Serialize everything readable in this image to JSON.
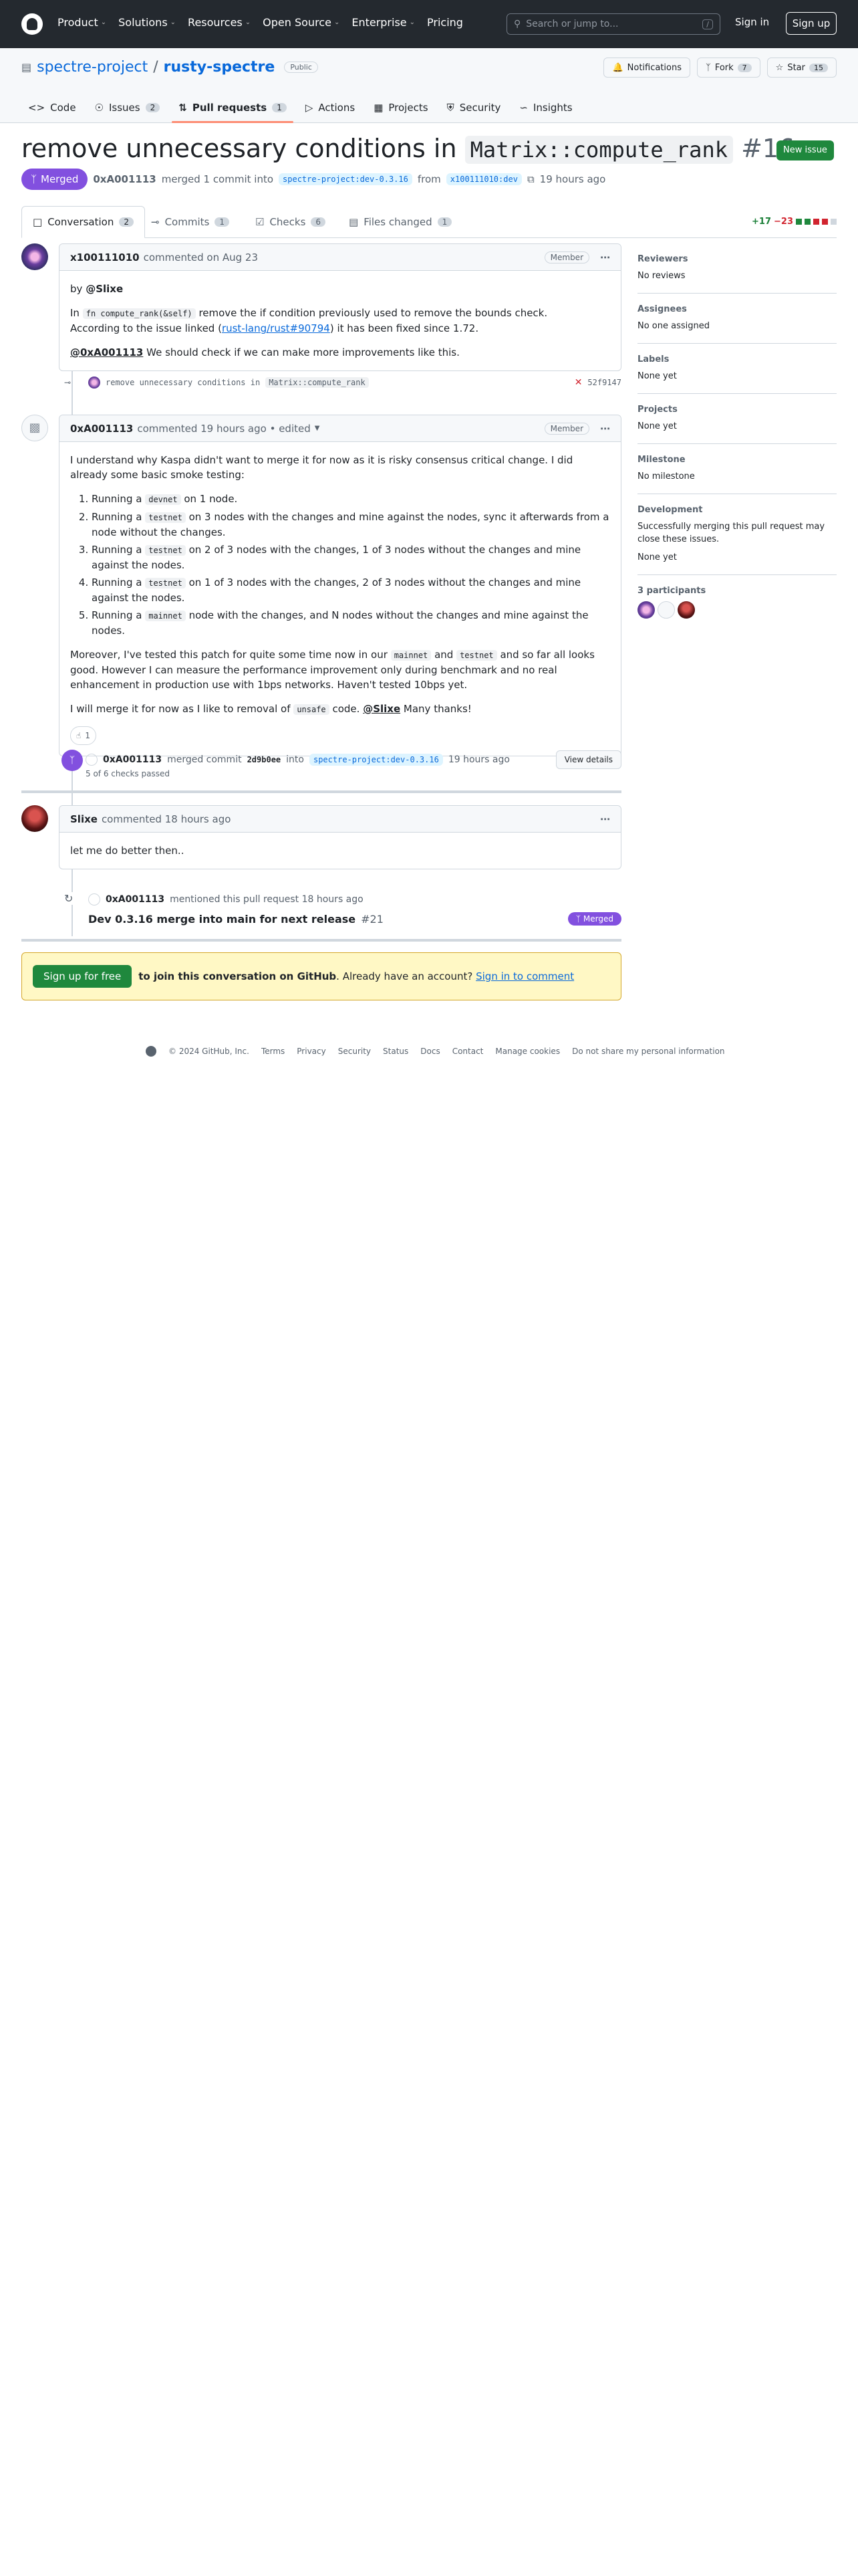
{
  "header": {
    "nav": [
      "Product",
      "Solutions",
      "Resources",
      "Open Source",
      "Enterprise",
      "Pricing"
    ],
    "search_placeholder": "Search or jump to...",
    "search_shortcut": "/",
    "signin": "Sign in",
    "signup": "Sign up"
  },
  "repo": {
    "owner": "spectre-project",
    "name": "rusty-spectre",
    "visibility": "Public",
    "notifications": "Notifications",
    "fork": "Fork",
    "fork_count": "7",
    "star": "Star",
    "star_count": "15",
    "tabs": [
      {
        "label": "Code",
        "count": ""
      },
      {
        "label": "Issues",
        "count": "2"
      },
      {
        "label": "Pull requests",
        "count": "1"
      },
      {
        "label": "Actions",
        "count": ""
      },
      {
        "label": "Projects",
        "count": ""
      },
      {
        "label": "Security",
        "count": ""
      },
      {
        "label": "Insights",
        "count": ""
      }
    ]
  },
  "pr": {
    "title_prefix": "remove unnecessary conditions in ",
    "title_code": "Matrix::compute_rank",
    "number": "#16",
    "new_issue": "New issue",
    "status": "Merged",
    "author": "0xA001113",
    "merge_text": "merged 1 commit into",
    "base_branch": "spectre-project:dev-0.3.16",
    "from": "from",
    "head_branch": "x100111010:dev",
    "time": "19 hours ago",
    "tabs": [
      {
        "label": "Conversation",
        "count": "2"
      },
      {
        "label": "Commits",
        "count": "1"
      },
      {
        "label": "Checks",
        "count": "6"
      },
      {
        "label": "Files changed",
        "count": "1"
      }
    ],
    "additions": "+17",
    "deletions": "−23"
  },
  "comments": {
    "c1": {
      "author": "x100111010",
      "meta": "commented on Aug 23",
      "role": "Member",
      "by": "by",
      "by_mention": "@Slixe",
      "line1_a": "In",
      "line1_code": "fn compute_rank(&self)",
      "line1_b": "remove the if condition previously used to remove the bounds check.",
      "line2_a": "According to the issue linked (",
      "line2_link": "rust-lang/rust#90794",
      "line2_b": ") it has been fixed since 1.72.",
      "line3_mention": "@0xA001113",
      "line3_b": "We should check if we can make more improvements like this."
    },
    "commit": {
      "text": "remove unnecessary conditions in",
      "code": "Matrix::compute_rank",
      "sha": "52f9147"
    },
    "c2": {
      "author": "0xA001113",
      "meta": "commented 19 hours ago • edited",
      "role": "Member",
      "p1": "I understand why Kaspa didn't want to merge it for now as it is risky consensus critical change. I did already some basic smoke testing:",
      "items": [
        {
          "a": "Running a",
          "code": "devnet",
          "b": "on 1 node."
        },
        {
          "a": "Running a",
          "code": "testnet",
          "b": "on 3 nodes with the changes and mine against the nodes, sync it afterwards from a node without the changes."
        },
        {
          "a": "Running a",
          "code": "testnet",
          "b": "on 2 of 3 nodes with the changes, 1 of 3 nodes without the changes and mine against the nodes."
        },
        {
          "a": "Running a",
          "code": "testnet",
          "b": "on 1 of 3 nodes with the changes, 2 of 3 nodes without the changes and mine against the nodes."
        },
        {
          "a": "Running a",
          "code": "mainnet",
          "b": "node with the changes, and N nodes without the changes and mine against the nodes."
        }
      ],
      "p2_a": "Moreover, I've tested this patch for quite some time now in our",
      "p2_code1": "mainnet",
      "p2_and": "and",
      "p2_code2": "testnet",
      "p2_b": "and so far all looks good. However I can measure the performance improvement only during benchmark and no real enhancement in production use with 1bps networks. Haven't tested 10bps yet.",
      "p3_a": "I will merge it for now as I like to removal of",
      "p3_code": "unsafe",
      "p3_b": "code.",
      "p3_mention": "@Slixe",
      "p3_c": "Many thanks!",
      "reaction_count": "1"
    },
    "merge_event": {
      "author": "0xA001113",
      "text": "merged commit",
      "sha": "2d9b0ee",
      "into": "into",
      "branch": "spectre-project:dev-0.3.16",
      "time": "19 hours ago",
      "checks": "5 of 6 checks passed",
      "view": "View details"
    },
    "c3": {
      "author": "Slixe",
      "meta": "commented 18 hours ago",
      "body": "let me do better then.."
    },
    "mention_event": {
      "author": "0xA001113",
      "text": "mentioned this pull request 18 hours ago",
      "ref_title": "Dev 0.3.16 merge into main for next release",
      "ref_num": "#21",
      "ref_status": "Merged"
    }
  },
  "signup_box": {
    "button": "Sign up for free",
    "bold": "to join this conversation on GitHub",
    "text": ". Already have an account?",
    "link": "Sign in to comment"
  },
  "sidebar": {
    "reviewers_h": "Reviewers",
    "reviewers_v": "No reviews",
    "assignees_h": "Assignees",
    "assignees_v": "No one assigned",
    "labels_h": "Labels",
    "labels_v": "None yet",
    "projects_h": "Projects",
    "projects_v": "None yet",
    "milestone_h": "Milestone",
    "milestone_v": "No milestone",
    "development_h": "Development",
    "development_p": "Successfully merging this pull request may close these issues.",
    "development_v": "None yet",
    "participants_h": "3 participants"
  },
  "footer": [
    "© 2024 GitHub, Inc.",
    "Terms",
    "Privacy",
    "Security",
    "Status",
    "Docs",
    "Contact",
    "Manage cookies",
    "Do not share my personal information"
  ],
  "colors": {
    "merged": "#8250df",
    "accent": "#0969da",
    "success": "#1f883d"
  }
}
